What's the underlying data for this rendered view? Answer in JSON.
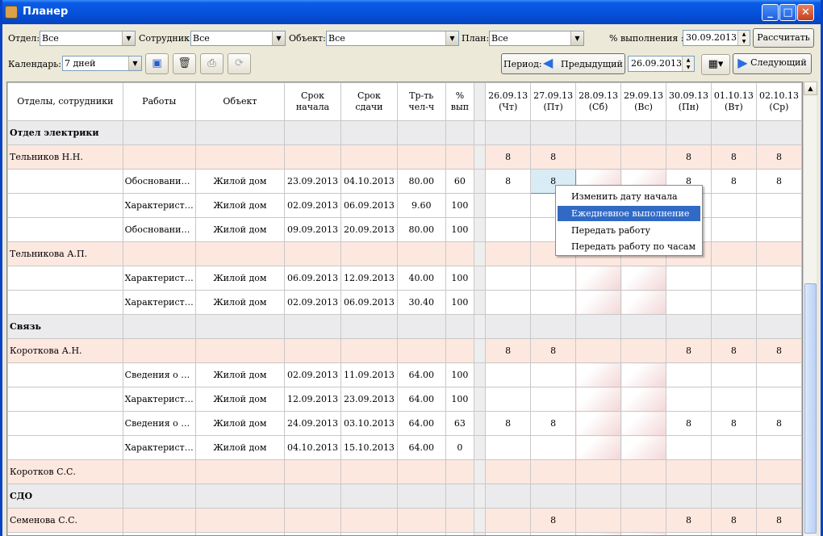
{
  "window": {
    "title": "Планер",
    "buttons": [
      "_",
      "□",
      "✕"
    ]
  },
  "filters": {
    "dept_label": "Отдел:",
    "dept_value": "Все",
    "employee_label": "Сотрудник:",
    "employee_value": "Все",
    "object_label": "Объект:",
    "object_value": "Все",
    "plan_label": "План:",
    "plan_value": "Все",
    "percent_label": "% выполнения :",
    "percent_date": "30.09.2013",
    "calc_button": "Рассчитать"
  },
  "toolbar": {
    "calendar_label": "Календарь:",
    "calendar_value": "7 дней",
    "period_label": "Период:",
    "prev_button": "Предыдущий",
    "period_date": "26.09.2013",
    "next_button": "Следующий"
  },
  "grid": {
    "headers": [
      "Отделы, сотрудники",
      "Работы",
      "Объект",
      "Срок\nначала",
      "Срок\nсдачи",
      "Тр-ть\nчел-ч",
      "%\nвып",
      "",
      "26.09.13\n(Чт)",
      "27.09.13\n(Пт)",
      "28.09.13\n(Сб)",
      "29.09.13\n(Вс)",
      "30.09.13\n(Пн)",
      "01.10.13\n(Вт)",
      "02.10.13\n(Ср)"
    ],
    "weekend_cols": [
      10,
      11
    ],
    "rows": [
      {
        "type": "dept",
        "cells": [
          "Отдел электрики",
          "",
          "",
          "",
          "",
          "",
          "",
          "",
          "",
          "",
          "",
          "",
          "",
          "",
          ""
        ]
      },
      {
        "type": "person",
        "cells": [
          "Тельников Н.Н.",
          "",
          "",
          "",
          "",
          "",
          "",
          "",
          "8",
          "8",
          "",
          "",
          "8",
          "8",
          "8"
        ]
      },
      {
        "type": "task",
        "cells": [
          "",
          "Обосновани…",
          "Жилой дом",
          "23.09.2013",
          "04.10.2013",
          "80.00",
          "60",
          "",
          "8",
          "8",
          "",
          "",
          "8",
          "8",
          "8"
        ]
      },
      {
        "type": "task",
        "cells": [
          "",
          "Характерист…",
          "Жилой дом",
          "02.09.2013",
          "06.09.2013",
          "9.60",
          "100",
          "",
          "",
          "",
          "",
          "",
          "",
          "",
          ""
        ]
      },
      {
        "type": "task",
        "cells": [
          "",
          "Обосновани…",
          "Жилой дом",
          "09.09.2013",
          "20.09.2013",
          "80.00",
          "100",
          "",
          "",
          "",
          "",
          "",
          "",
          "",
          ""
        ]
      },
      {
        "type": "person",
        "cells": [
          "Тельникова А.П.",
          "",
          "",
          "",
          "",
          "",
          "",
          "",
          "",
          "",
          "",
          "",
          "",
          "",
          ""
        ]
      },
      {
        "type": "task",
        "cells": [
          "",
          "Характерист…",
          "Жилой дом",
          "06.09.2013",
          "12.09.2013",
          "40.00",
          "100",
          "",
          "",
          "",
          "",
          "",
          "",
          "",
          ""
        ]
      },
      {
        "type": "task",
        "cells": [
          "",
          "Характерист…",
          "Жилой дом",
          "02.09.2013",
          "06.09.2013",
          "30.40",
          "100",
          "",
          "",
          "",
          "",
          "",
          "",
          "",
          ""
        ]
      },
      {
        "type": "dept",
        "cells": [
          "Связь",
          "",
          "",
          "",
          "",
          "",
          "",
          "",
          "",
          "",
          "",
          "",
          "",
          "",
          ""
        ]
      },
      {
        "type": "person",
        "cells": [
          "Короткова А.Н.",
          "",
          "",
          "",
          "",
          "",
          "",
          "",
          "8",
          "8",
          "",
          "",
          "8",
          "8",
          "8"
        ]
      },
      {
        "type": "task",
        "cells": [
          "",
          "Сведения о …",
          "Жилой дом",
          "02.09.2013",
          "11.09.2013",
          "64.00",
          "100",
          "",
          "",
          "",
          "",
          "",
          "",
          "",
          ""
        ]
      },
      {
        "type": "task",
        "cells": [
          "",
          "Характерист…",
          "Жилой дом",
          "12.09.2013",
          "23.09.2013",
          "64.00",
          "100",
          "",
          "",
          "",
          "",
          "",
          "",
          "",
          ""
        ]
      },
      {
        "type": "task",
        "cells": [
          "",
          "Сведения о …",
          "Жилой дом",
          "24.09.2013",
          "03.10.2013",
          "64.00",
          "63",
          "",
          "8",
          "8",
          "",
          "",
          "8",
          "8",
          "8"
        ]
      },
      {
        "type": "task",
        "cells": [
          "",
          "Характерист…",
          "Жилой дом",
          "04.10.2013",
          "15.10.2013",
          "64.00",
          "0",
          "",
          "",
          "",
          "",
          "",
          "",
          "",
          ""
        ]
      },
      {
        "type": "person",
        "cells": [
          "Коротков С.С.",
          "",
          "",
          "",
          "",
          "",
          "",
          "",
          "",
          "",
          "",
          "",
          "",
          "",
          ""
        ]
      },
      {
        "type": "dept",
        "cells": [
          "СДО",
          "",
          "",
          "",
          "",
          "",
          "",
          "",
          "",
          "",
          "",
          "",
          "",
          "",
          ""
        ]
      },
      {
        "type": "person",
        "cells": [
          "Семенова С.С.",
          "",
          "",
          "",
          "",
          "",
          "",
          "",
          "",
          "8",
          "",
          "",
          "8",
          "8",
          "8"
        ]
      },
      {
        "type": "task",
        "cells": [
          "",
          "",
          "",
          "",
          "",
          "",
          "",
          "",
          "",
          "",
          "",
          "",
          "",
          "",
          ""
        ]
      }
    ]
  },
  "context_menu": {
    "items": [
      "Изменить дату начала",
      "Ежедневное выполнение",
      "Передать работу",
      "Передать работу по часам"
    ],
    "highlighted": 1
  }
}
